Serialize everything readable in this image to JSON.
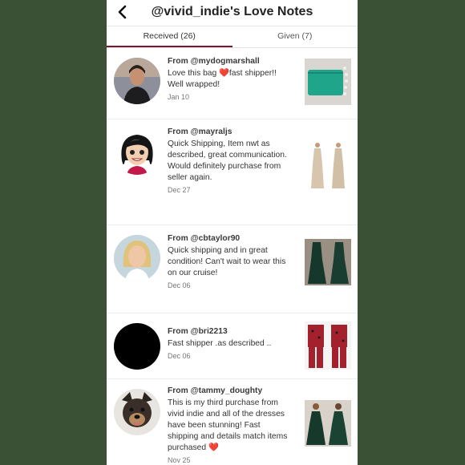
{
  "header": {
    "title": "@vivid_indie's Love Notes",
    "back_icon": "back-chevron-icon"
  },
  "tabs": [
    {
      "label": "Received (26)",
      "active": true
    },
    {
      "label": "Given (7)",
      "active": false
    }
  ],
  "notes": [
    {
      "from": "From @mydogmarshall",
      "message": "Love this bag ❤️fast shipper!! Well wrapped!",
      "date": "Jan 10"
    },
    {
      "from": "From @mayraljs",
      "message": "Quick Shipping, Item nwt as described, great communication. Would definitely purchase from seller again.",
      "date": "Dec 27"
    },
    {
      "from": "From @cbtaylor90",
      "message": "Quick shipping and in great condition! Can't wait to wear this on our cruise!",
      "date": "Dec 06"
    },
    {
      "from": "From @bri2213",
      "message": "Fast shipper .as described ..",
      "date": "Dec 06"
    },
    {
      "from": "From @tammy_doughty",
      "message": "This is my third purchase from vivid indie and all of the dresses have been stunning! Fast shipping and details match items purchased ❤️",
      "date": "Nov 25"
    }
  ],
  "colors": {
    "background": "#3b5136",
    "tab_underline": "#7b1630",
    "heart": "#e0242c"
  }
}
